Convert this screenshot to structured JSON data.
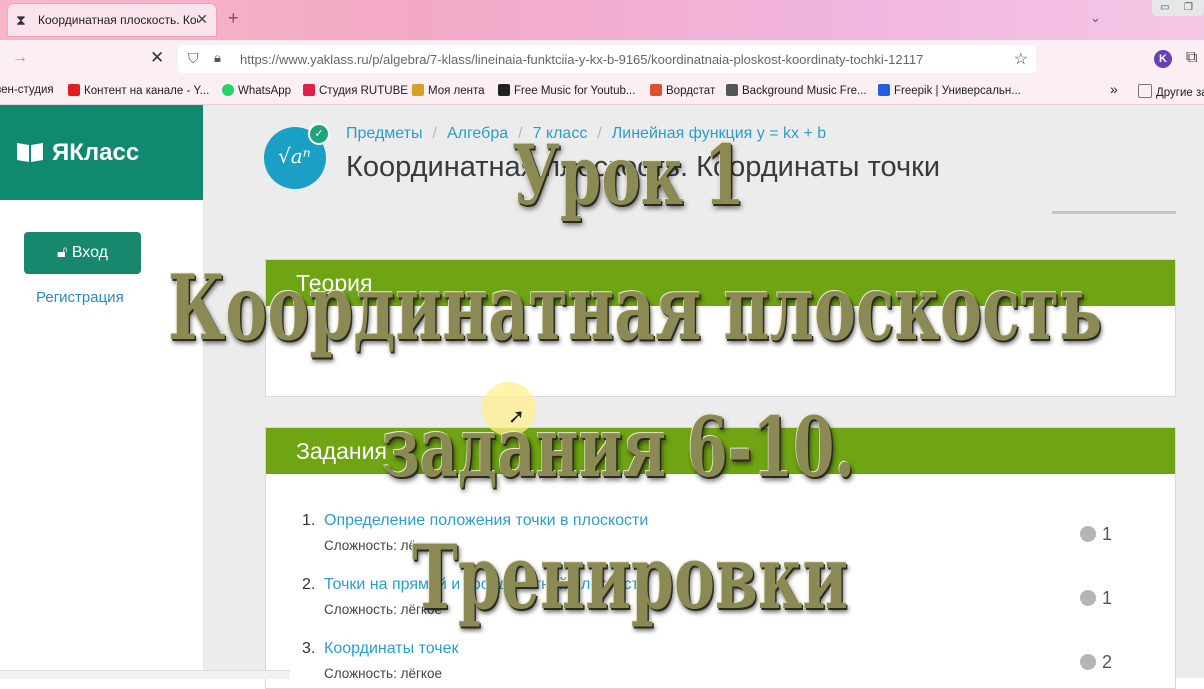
{
  "browser": {
    "tab_title": "Координатная плоскость. Коо",
    "url": "https://www.yaklass.ru/p/algebra/7-klass/lineinaia-funktciia-y-kx-b-9165/koordinatnaia-ploskost-koordinaty-tochki-12117",
    "account_letter": "K",
    "bookmarks": [
      {
        "label": "зен-студия",
        "color": "#f3a9c6"
      },
      {
        "label": "Контент на канале - Y...",
        "color": "#e02020"
      },
      {
        "label": "WhatsApp",
        "color": "#25d366"
      },
      {
        "label": "Студия RUTUBE",
        "color": "#e0204a"
      },
      {
        "label": "Моя лента",
        "color": "#d8a020"
      },
      {
        "label": "Free Music for Youtub...",
        "color": "#222222"
      },
      {
        "label": "Вордстат",
        "color": "#e05030"
      },
      {
        "label": "Background Music Fre...",
        "color": "#555555"
      },
      {
        "label": "Freepik | Универсальн...",
        "color": "#2060e0"
      },
      {
        "label": "Другие за",
        "color": "#777777"
      }
    ]
  },
  "sidebar": {
    "logo_text": "ЯКласс",
    "login_label": "Вход",
    "register_label": "Регистрация"
  },
  "breadcrumbs": [
    "Предметы",
    "Алгебра",
    "7 класс",
    "Линейная функция y = kx + b"
  ],
  "page_title": "Координатная плоскость. Координаты точки",
  "badge_symbol": "√aⁿ",
  "theory": {
    "title": "Теория"
  },
  "tasks": {
    "title": "Задания",
    "items": [
      {
        "num": "1.",
        "title": "Определение положения точки в плоскости",
        "difficulty": "Сложность: лёгкое",
        "points": "1"
      },
      {
        "num": "2.",
        "title": "Точки на прямой и координатной плоскости",
        "difficulty": "Сложность: лёгкое",
        "points": "1"
      },
      {
        "num": "3.",
        "title": "Координаты точек",
        "difficulty": "Сложность: лёгкое",
        "points": "2"
      }
    ]
  },
  "overlay": {
    "line1": "Урок 1",
    "line2": "Координатная плоскость",
    "line3": "задания 6-10.",
    "line4": "Тренировки"
  }
}
